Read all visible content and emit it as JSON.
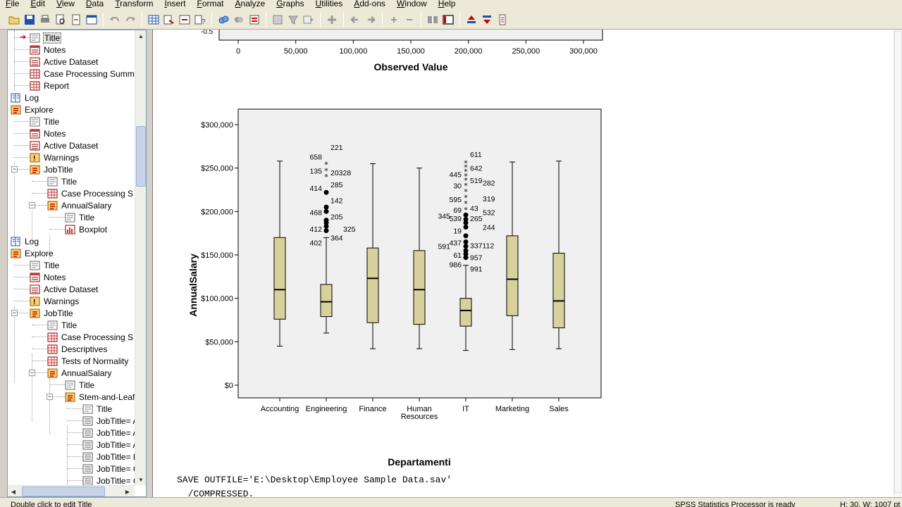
{
  "menu": [
    "File",
    "Edit",
    "View",
    "Data",
    "Transform",
    "Insert",
    "Format",
    "Analyze",
    "Graphs",
    "Utilities",
    "Add-ons",
    "Window",
    "Help"
  ],
  "outline": {
    "nodes": [
      {
        "label": "Title",
        "depth": 1,
        "icon": "title-icon",
        "selected": true
      },
      {
        "label": "Notes",
        "depth": 1,
        "icon": "notes-icon"
      },
      {
        "label": "Active Dataset",
        "depth": 1,
        "icon": "dataset-icon"
      },
      {
        "label": "Case Processing Summ",
        "depth": 1,
        "icon": "table-icon"
      },
      {
        "label": "Report",
        "depth": 1,
        "icon": "table-icon"
      },
      {
        "label": "Log",
        "depth": 0,
        "icon": "log-icon"
      },
      {
        "label": "Explore",
        "depth": 0,
        "icon": "procedure-icon"
      },
      {
        "label": "Title",
        "depth": 1,
        "icon": "title-icon"
      },
      {
        "label": "Notes",
        "depth": 1,
        "icon": "notes-icon"
      },
      {
        "label": "Active Dataset",
        "depth": 1,
        "icon": "dataset-icon"
      },
      {
        "label": "Warnings",
        "depth": 1,
        "icon": "warning-icon"
      },
      {
        "label": "JobTitle",
        "depth": 1,
        "icon": "procedure-icon",
        "expander": "-"
      },
      {
        "label": "Title",
        "depth": 2,
        "icon": "title-icon"
      },
      {
        "label": "Case Processing S",
        "depth": 2,
        "icon": "table-icon"
      },
      {
        "label": "AnnualSalary",
        "depth": 2,
        "icon": "procedure-icon",
        "expander": "-"
      },
      {
        "label": "Title",
        "depth": 3,
        "icon": "title-icon"
      },
      {
        "label": "Boxplot",
        "depth": 3,
        "icon": "chart-icon"
      },
      {
        "label": "Log",
        "depth": 0,
        "icon": "log-icon"
      },
      {
        "label": "Explore",
        "depth": 0,
        "icon": "procedure-icon"
      },
      {
        "label": "Title",
        "depth": 1,
        "icon": "title-icon"
      },
      {
        "label": "Notes",
        "depth": 1,
        "icon": "notes-icon"
      },
      {
        "label": "Active Dataset",
        "depth": 1,
        "icon": "dataset-icon"
      },
      {
        "label": "Warnings",
        "depth": 1,
        "icon": "warning-icon"
      },
      {
        "label": "JobTitle",
        "depth": 1,
        "icon": "procedure-icon",
        "expander": "-"
      },
      {
        "label": "Title",
        "depth": 2,
        "icon": "title-icon"
      },
      {
        "label": "Case Processing S",
        "depth": 2,
        "icon": "table-icon"
      },
      {
        "label": "Descriptives",
        "depth": 2,
        "icon": "table-icon"
      },
      {
        "label": "Tests of Normality",
        "depth": 2,
        "icon": "table-icon"
      },
      {
        "label": "AnnualSalary",
        "depth": 2,
        "icon": "procedure-icon",
        "expander": "-"
      },
      {
        "label": "Title",
        "depth": 3,
        "icon": "title-icon"
      },
      {
        "label": "Stem-and-Leaf",
        "depth": 3,
        "icon": "procedure-icon",
        "expander": "-"
      },
      {
        "label": "Title",
        "depth": 4,
        "icon": "title-icon"
      },
      {
        "label": "JobTitle= A",
        "depth": 4,
        "icon": "text-icon"
      },
      {
        "label": "JobTitle= A",
        "depth": 4,
        "icon": "text-icon"
      },
      {
        "label": "JobTitle= A",
        "depth": 4,
        "icon": "text-icon"
      },
      {
        "label": "JobTitle= E",
        "depth": 4,
        "icon": "text-icon"
      },
      {
        "label": "JobTitle= C",
        "depth": 4,
        "icon": "text-icon"
      },
      {
        "label": "JobTitle= C",
        "depth": 4,
        "icon": "text-icon"
      }
    ]
  },
  "upper_chart": {
    "ticks": [
      "0",
      "50,000",
      "100,000",
      "150,000",
      "200,000",
      "250,000",
      "300,000"
    ],
    "tick_values": [
      0,
      50000,
      100000,
      150000,
      200000,
      250000,
      300000
    ],
    "top_fragment": "-0.5",
    "xlabel": "Observed Value"
  },
  "chart_data": {
    "type": "box",
    "xlabel": "Departamenti",
    "ylabel": "AnnualSalary",
    "ylim": [
      0,
      300000
    ],
    "y_ticks": [
      "$0",
      "$50,000",
      "$100,000",
      "$150,000",
      "$200,000",
      "$250,000",
      "$300,000"
    ],
    "y_tick_values": [
      0,
      50000,
      100000,
      150000,
      200000,
      250000,
      300000
    ],
    "categories": [
      "Accounting",
      "Engineering",
      "Finance",
      "Human Resources",
      "IT",
      "Marketing",
      "Sales"
    ],
    "boxes": [
      {
        "min": 45000,
        "q1": 76000,
        "median": 110000,
        "q3": 170000,
        "max": 258000
      },
      {
        "min": 60000,
        "q1": 79000,
        "median": 96000,
        "q3": 116000,
        "max": 170000
      },
      {
        "min": 42000,
        "q1": 72000,
        "median": 123000,
        "q3": 158000,
        "max": 255000
      },
      {
        "min": 42000,
        "q1": 70000,
        "median": 110000,
        "q3": 155000,
        "max": 250000
      },
      {
        "min": 40000,
        "q1": 68000,
        "median": 86000,
        "q3": 100000,
        "max": 138000
      },
      {
        "min": 41000,
        "q1": 80000,
        "median": 122000,
        "q3": 172000,
        "max": 257000
      },
      {
        "min": 42000,
        "q1": 66000,
        "median": 97000,
        "q3": 152000,
        "max": 258000
      }
    ],
    "outliers": [
      {
        "cat": 1,
        "y": 178000,
        "kind": "circle"
      },
      {
        "cat": 1,
        "y": 183000,
        "kind": "circle"
      },
      {
        "cat": 1,
        "y": 187000,
        "kind": "circle"
      },
      {
        "cat": 1,
        "y": 190000,
        "kind": "circle"
      },
      {
        "cat": 1,
        "y": 200000,
        "kind": "circle"
      },
      {
        "cat": 1,
        "y": 205000,
        "kind": "circle"
      },
      {
        "cat": 1,
        "y": 222000,
        "kind": "circle"
      },
      {
        "cat": 1,
        "y": 240000,
        "kind": "star"
      },
      {
        "cat": 1,
        "y": 247000,
        "kind": "star"
      },
      {
        "cat": 1,
        "y": 254000,
        "kind": "star"
      },
      {
        "cat": 4,
        "y": 147000,
        "kind": "circle"
      },
      {
        "cat": 4,
        "y": 151000,
        "kind": "circle"
      },
      {
        "cat": 4,
        "y": 155000,
        "kind": "circle"
      },
      {
        "cat": 4,
        "y": 160000,
        "kind": "circle"
      },
      {
        "cat": 4,
        "y": 165000,
        "kind": "circle"
      },
      {
        "cat": 4,
        "y": 172000,
        "kind": "circle"
      },
      {
        "cat": 4,
        "y": 182000,
        "kind": "circle"
      },
      {
        "cat": 4,
        "y": 187000,
        "kind": "circle"
      },
      {
        "cat": 4,
        "y": 191000,
        "kind": "circle"
      },
      {
        "cat": 4,
        "y": 196000,
        "kind": "circle"
      },
      {
        "cat": 4,
        "y": 202000,
        "kind": "star"
      },
      {
        "cat": 4,
        "y": 209000,
        "kind": "star"
      },
      {
        "cat": 4,
        "y": 216000,
        "kind": "star"
      },
      {
        "cat": 4,
        "y": 223000,
        "kind": "star"
      },
      {
        "cat": 4,
        "y": 230000,
        "kind": "star"
      },
      {
        "cat": 4,
        "y": 236000,
        "kind": "star"
      },
      {
        "cat": 4,
        "y": 241000,
        "kind": "star"
      },
      {
        "cat": 4,
        "y": 246000,
        "kind": "star"
      },
      {
        "cat": 4,
        "y": 251000,
        "kind": "star"
      },
      {
        "cat": 4,
        "y": 256000,
        "kind": "star"
      }
    ],
    "outlier_labels": [
      {
        "cat": 1,
        "text": "221",
        "y": 274000,
        "side": "right"
      },
      {
        "cat": 1,
        "text": "658",
        "y": 263000,
        "side": "left"
      },
      {
        "cat": 1,
        "text": "135",
        "y": 247000,
        "side": "left"
      },
      {
        "cat": 1,
        "text": "20328",
        "y": 245000,
        "side": "right"
      },
      {
        "cat": 1,
        "text": "285",
        "y": 231000,
        "side": "right"
      },
      {
        "cat": 1,
        "text": "414",
        "y": 227000,
        "side": "left"
      },
      {
        "cat": 1,
        "text": "142",
        "y": 213000,
        "side": "right"
      },
      {
        "cat": 1,
        "text": "468",
        "y": 199000,
        "side": "left"
      },
      {
        "cat": 1,
        "text": "205",
        "y": 194000,
        "side": "right"
      },
      {
        "cat": 1,
        "text": "412",
        "y": 180000,
        "side": "left"
      },
      {
        "cat": 1,
        "text": "325",
        "y": 180000,
        "side": "far-right"
      },
      {
        "cat": 1,
        "text": "364",
        "y": 170000,
        "side": "right"
      },
      {
        "cat": 1,
        "text": "402",
        "y": 164000,
        "side": "left"
      },
      {
        "cat": 4,
        "text": "611",
        "y": 266000,
        "side": "right"
      },
      {
        "cat": 4,
        "text": "642",
        "y": 250000,
        "side": "right"
      },
      {
        "cat": 4,
        "text": "445",
        "y": 243000,
        "side": "left"
      },
      {
        "cat": 4,
        "text": "519",
        "y": 236000,
        "side": "right"
      },
      {
        "cat": 4,
        "text": "282",
        "y": 233000,
        "side": "far-right"
      },
      {
        "cat": 4,
        "text": "30",
        "y": 230000,
        "side": "left"
      },
      {
        "cat": 4,
        "text": "319",
        "y": 215000,
        "side": "far-right"
      },
      {
        "cat": 4,
        "text": "595",
        "y": 214000,
        "side": "left"
      },
      {
        "cat": 4,
        "text": "43",
        "y": 204000,
        "side": "right"
      },
      {
        "cat": 4,
        "text": "69",
        "y": 202000,
        "side": "left"
      },
      {
        "cat": 4,
        "text": "532",
        "y": 199000,
        "side": "far-right"
      },
      {
        "cat": 4,
        "text": "345",
        "y": 195000,
        "side": "far-left"
      },
      {
        "cat": 4,
        "text": "539",
        "y": 192000,
        "side": "left"
      },
      {
        "cat": 4,
        "text": "265",
        "y": 192000,
        "side": "right"
      },
      {
        "cat": 4,
        "text": "244",
        "y": 182000,
        "side": "far-right"
      },
      {
        "cat": 4,
        "text": "19",
        "y": 178000,
        "side": "left"
      },
      {
        "cat": 4,
        "text": "437",
        "y": 164000,
        "side": "left"
      },
      {
        "cat": 4,
        "text": "337112",
        "y": 161000,
        "side": "right"
      },
      {
        "cat": 4,
        "text": "591",
        "y": 160000,
        "side": "far-left"
      },
      {
        "cat": 4,
        "text": "61",
        "y": 150000,
        "side": "left"
      },
      {
        "cat": 4,
        "text": "957",
        "y": 147000,
        "side": "right"
      },
      {
        "cat": 4,
        "text": "986",
        "y": 139000,
        "side": "left"
      },
      {
        "cat": 4,
        "text": "991",
        "y": 134000,
        "side": "right"
      }
    ],
    "box_color": "#d7d19b",
    "plot_bg": "#f0f0f0"
  },
  "syntax": {
    "line1": "SAVE OUTFILE='E:\\Desktop\\Employee Sample Data.sav'",
    "line2": "  /COMPRESSED."
  },
  "status": {
    "hint": "Double click to edit Title",
    "processor": "SPSS Statistics  Processor is ready",
    "dims": "H: 30, W: 1007 pt"
  }
}
